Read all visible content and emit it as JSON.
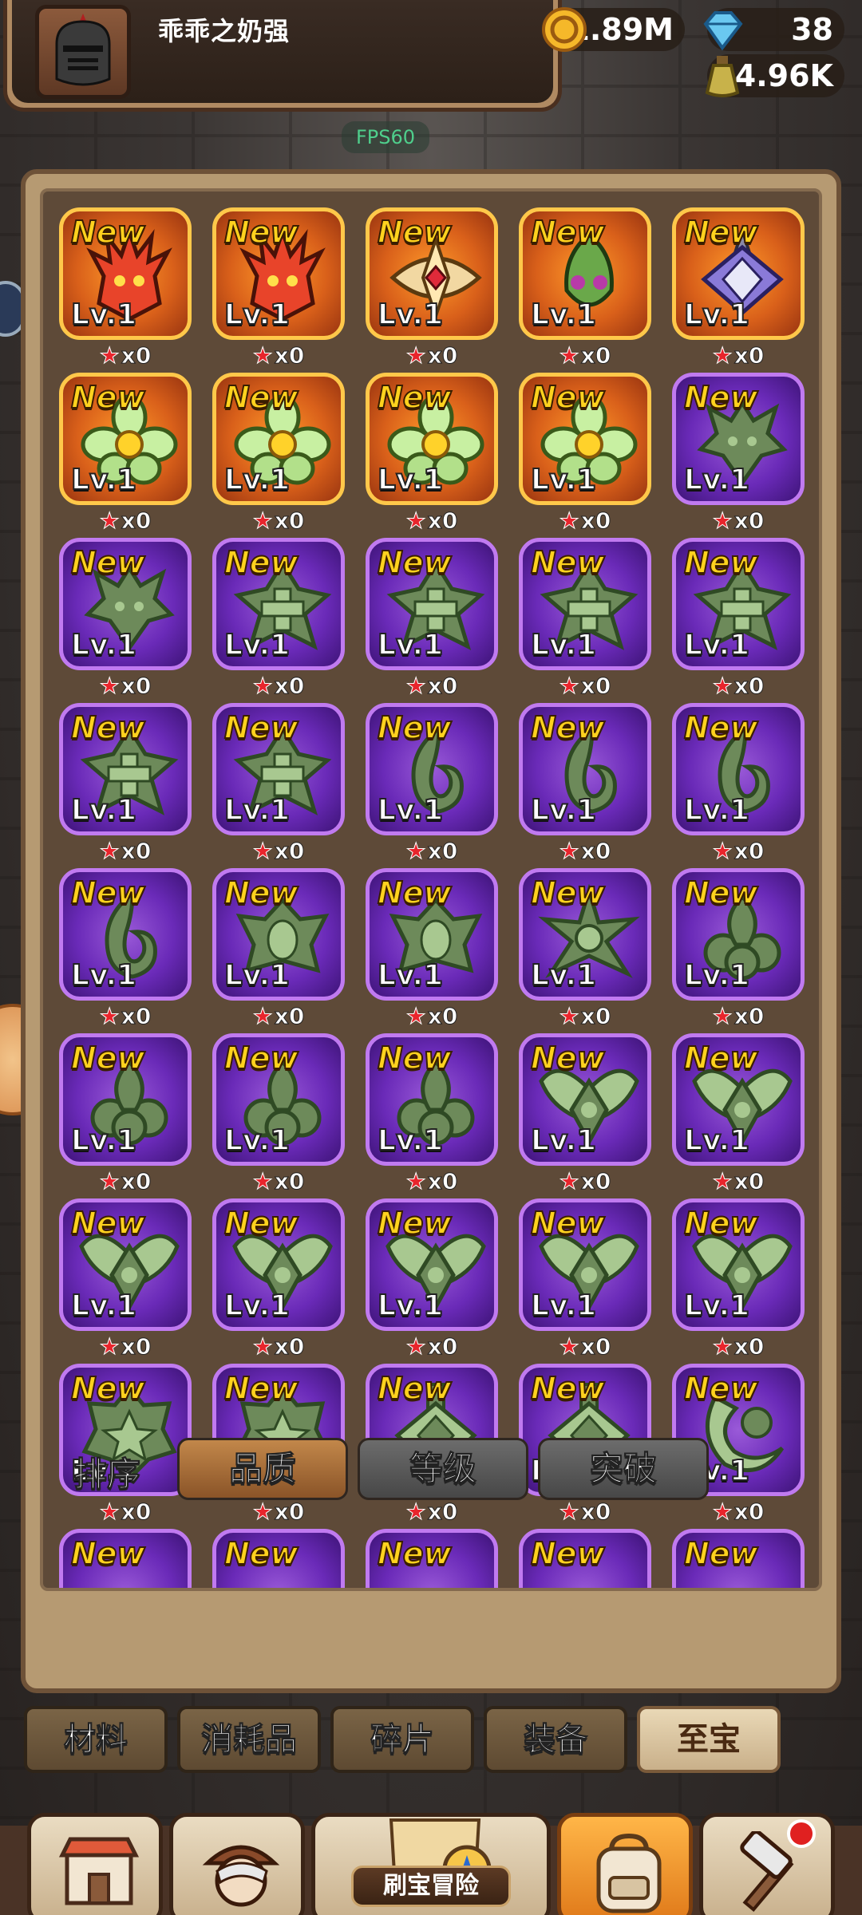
{
  "header": {
    "username": "乖乖之奶强",
    "gold": "1.89M",
    "gems": "38",
    "potion": "4.96K",
    "fps": "FPS60"
  },
  "icons": {
    "gold": "gold-coin-icon",
    "gems": "blue-gem-icon",
    "potion": "potion-bottle-icon",
    "avatar": "knight-helmet-avatar"
  },
  "grid": {
    "new_label": "New",
    "level_label": "Lv.1",
    "count_label": "x0",
    "items": [
      {
        "rarity": "gold",
        "icon": "flame-demon"
      },
      {
        "rarity": "gold",
        "icon": "flame-demon"
      },
      {
        "rarity": "gold",
        "icon": "gem-cross"
      },
      {
        "rarity": "gold",
        "icon": "leaf-mask"
      },
      {
        "rarity": "gold",
        "icon": "blade-diamond"
      },
      {
        "rarity": "gold",
        "icon": "flower"
      },
      {
        "rarity": "gold",
        "icon": "flower"
      },
      {
        "rarity": "gold",
        "icon": "flower"
      },
      {
        "rarity": "gold",
        "icon": "flower"
      },
      {
        "rarity": "purple",
        "icon": "dragon-head"
      },
      {
        "rarity": "purple",
        "icon": "dragon-head"
      },
      {
        "rarity": "purple",
        "icon": "cross-shield"
      },
      {
        "rarity": "purple",
        "icon": "cross-shield"
      },
      {
        "rarity": "purple",
        "icon": "cross-shield"
      },
      {
        "rarity": "purple",
        "icon": "cross-shield"
      },
      {
        "rarity": "purple",
        "icon": "cross-shield"
      },
      {
        "rarity": "purple",
        "icon": "cross-shield"
      },
      {
        "rarity": "purple",
        "icon": "hook-leaf"
      },
      {
        "rarity": "purple",
        "icon": "hook-leaf"
      },
      {
        "rarity": "purple",
        "icon": "hook-leaf"
      },
      {
        "rarity": "purple",
        "icon": "hook-leaf"
      },
      {
        "rarity": "purple",
        "icon": "winged-mask"
      },
      {
        "rarity": "purple",
        "icon": "winged-mask"
      },
      {
        "rarity": "purple",
        "icon": "spiked-star"
      },
      {
        "rarity": "purple",
        "icon": "clover"
      },
      {
        "rarity": "purple",
        "icon": "clover"
      },
      {
        "rarity": "purple",
        "icon": "clover"
      },
      {
        "rarity": "purple",
        "icon": "clover"
      },
      {
        "rarity": "purple",
        "icon": "wings"
      },
      {
        "rarity": "purple",
        "icon": "wings"
      },
      {
        "rarity": "purple",
        "icon": "wings"
      },
      {
        "rarity": "purple",
        "icon": "wings"
      },
      {
        "rarity": "purple",
        "icon": "wings"
      },
      {
        "rarity": "purple",
        "icon": "wings"
      },
      {
        "rarity": "purple",
        "icon": "wings"
      },
      {
        "rarity": "purple",
        "icon": "star-shield"
      },
      {
        "rarity": "purple",
        "icon": "star-shield"
      },
      {
        "rarity": "purple",
        "icon": "diamond-blade"
      },
      {
        "rarity": "purple",
        "icon": "diamond-blade"
      },
      {
        "rarity": "purple",
        "icon": "crescent"
      },
      {
        "rarity": "purple",
        "icon": "partial"
      },
      {
        "rarity": "purple",
        "icon": "partial"
      },
      {
        "rarity": "purple",
        "icon": "partial"
      },
      {
        "rarity": "purple",
        "icon": "partial"
      },
      {
        "rarity": "purple",
        "icon": "partial"
      }
    ]
  },
  "sort": {
    "label": "排序",
    "buttons": [
      "品质",
      "等级",
      "突破"
    ],
    "active": 0
  },
  "tabs": {
    "items": [
      "材料",
      "消耗品",
      "碎片",
      "装备",
      "至宝"
    ],
    "active": 4
  },
  "dock": {
    "adventure_label": "刷宝冒险",
    "items": [
      "shop-icon",
      "hero-icon",
      "adventure-map-icon",
      "backpack-icon",
      "forge-icon"
    ],
    "active": 3
  },
  "colors": {
    "gold_card": "#d9601a",
    "purple_card": "#6a2ab8",
    "new_text": "#ffd21e",
    "panel": "#5e4a38"
  }
}
